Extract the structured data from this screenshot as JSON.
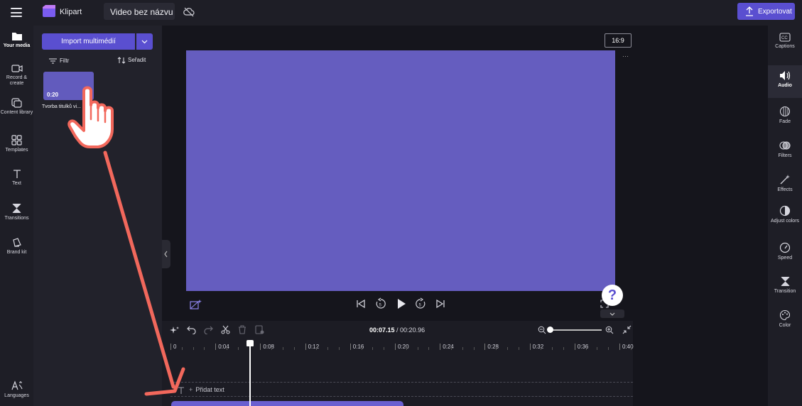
{
  "app": {
    "name": "Klipart",
    "project_title": "Video bez názvu",
    "export_label": "Exportovat"
  },
  "leftnav": {
    "items": [
      {
        "label": "Your media"
      },
      {
        "label": "Record & create"
      },
      {
        "label": "Content library"
      },
      {
        "label": "Templates"
      },
      {
        "label": "Text"
      },
      {
        "label": "Transitions"
      },
      {
        "label": "Brand kit"
      },
      {
        "label": "Languages"
      }
    ]
  },
  "media": {
    "import_label": "Import multimédií",
    "filter_label": "Filtr",
    "sort_label": "Seřadit",
    "clip": {
      "duration": "0:20",
      "name": "Tvorba titulků vi..."
    }
  },
  "preview": {
    "aspect_ratio": "16:9",
    "canvas_color": "#655dbf",
    "help_glyph": "?"
  },
  "rightpanel": {
    "items": [
      {
        "label": "Captions"
      },
      {
        "label": "Audio"
      },
      {
        "label": "Fade"
      },
      {
        "label": "Filters"
      },
      {
        "label": "Effects"
      },
      {
        "label": "Adjust colors"
      },
      {
        "label": "Speed"
      },
      {
        "label": "Transition"
      },
      {
        "label": "Color"
      }
    ]
  },
  "timeline": {
    "current_time": "00:07.15",
    "separator": " / ",
    "total_time": "00:20.96",
    "ruler_ticks": [
      "0",
      "0:04",
      "0:08",
      "0:12",
      "0:16",
      "0:20",
      "0:24",
      "0:28",
      "0:32",
      "0:36",
      "0:40"
    ],
    "add_text_label": "Přidat text"
  },
  "colors": {
    "accent": "#5a4fd0",
    "annotation": "#f2685c"
  }
}
